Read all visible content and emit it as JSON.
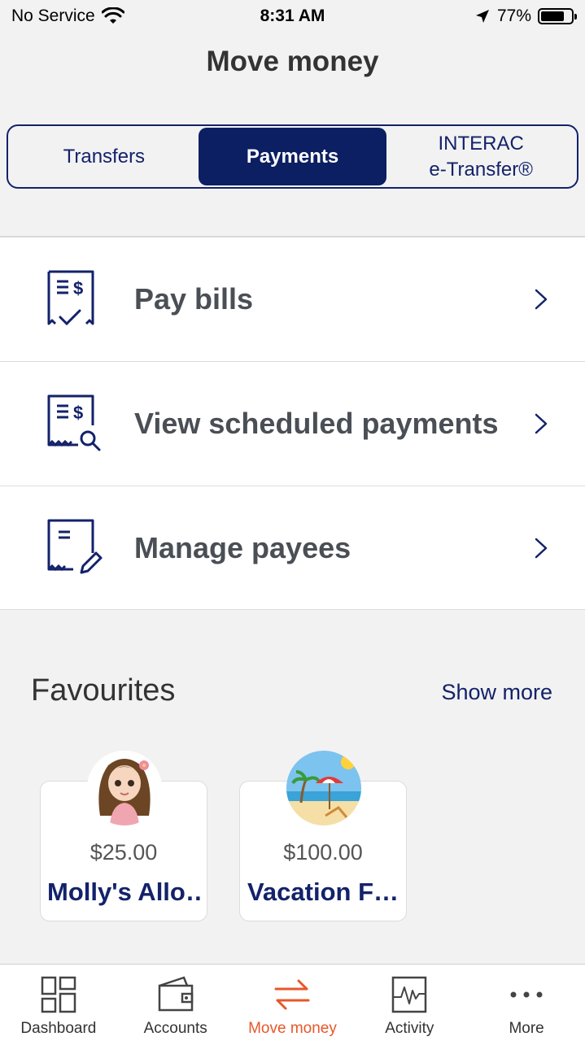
{
  "status_bar": {
    "carrier": "No Service",
    "time": "8:31 AM",
    "battery": "77%",
    "battery_level": 0.77
  },
  "header": {
    "title": "Move money"
  },
  "segments": [
    {
      "line1": "Transfers",
      "line2": "",
      "active": false
    },
    {
      "line1": "Payments",
      "line2": "",
      "active": true
    },
    {
      "line1": "INTERAC",
      "line2": "e-Transfer®",
      "active": false
    }
  ],
  "menu": [
    {
      "label": "Pay bills",
      "icon": "bill-check-icon"
    },
    {
      "label": "View scheduled payments",
      "icon": "bill-search-icon"
    },
    {
      "label": "Manage payees",
      "icon": "bill-edit-icon"
    }
  ],
  "favourites": {
    "title": "Favourites",
    "show_more": "Show more",
    "items": [
      {
        "amount": "$25.00",
        "name": "Molly's Allo…",
        "avatar": "girl-avatar"
      },
      {
        "amount": "$100.00",
        "name": "Vacation F…",
        "avatar": "beach-avatar"
      }
    ]
  },
  "tabbar": [
    {
      "label": "Dashboard",
      "icon": "dashboard-icon",
      "active": false
    },
    {
      "label": "Accounts",
      "icon": "wallet-icon",
      "active": false
    },
    {
      "label": "Move money",
      "icon": "transfer-arrows-icon",
      "active": true
    },
    {
      "label": "Activity",
      "icon": "activity-chart-icon",
      "active": false
    },
    {
      "label": "More",
      "icon": "more-dots-icon",
      "active": false
    }
  ],
  "colors": {
    "navy": "#0c1f62",
    "accent": "#e8572a"
  }
}
